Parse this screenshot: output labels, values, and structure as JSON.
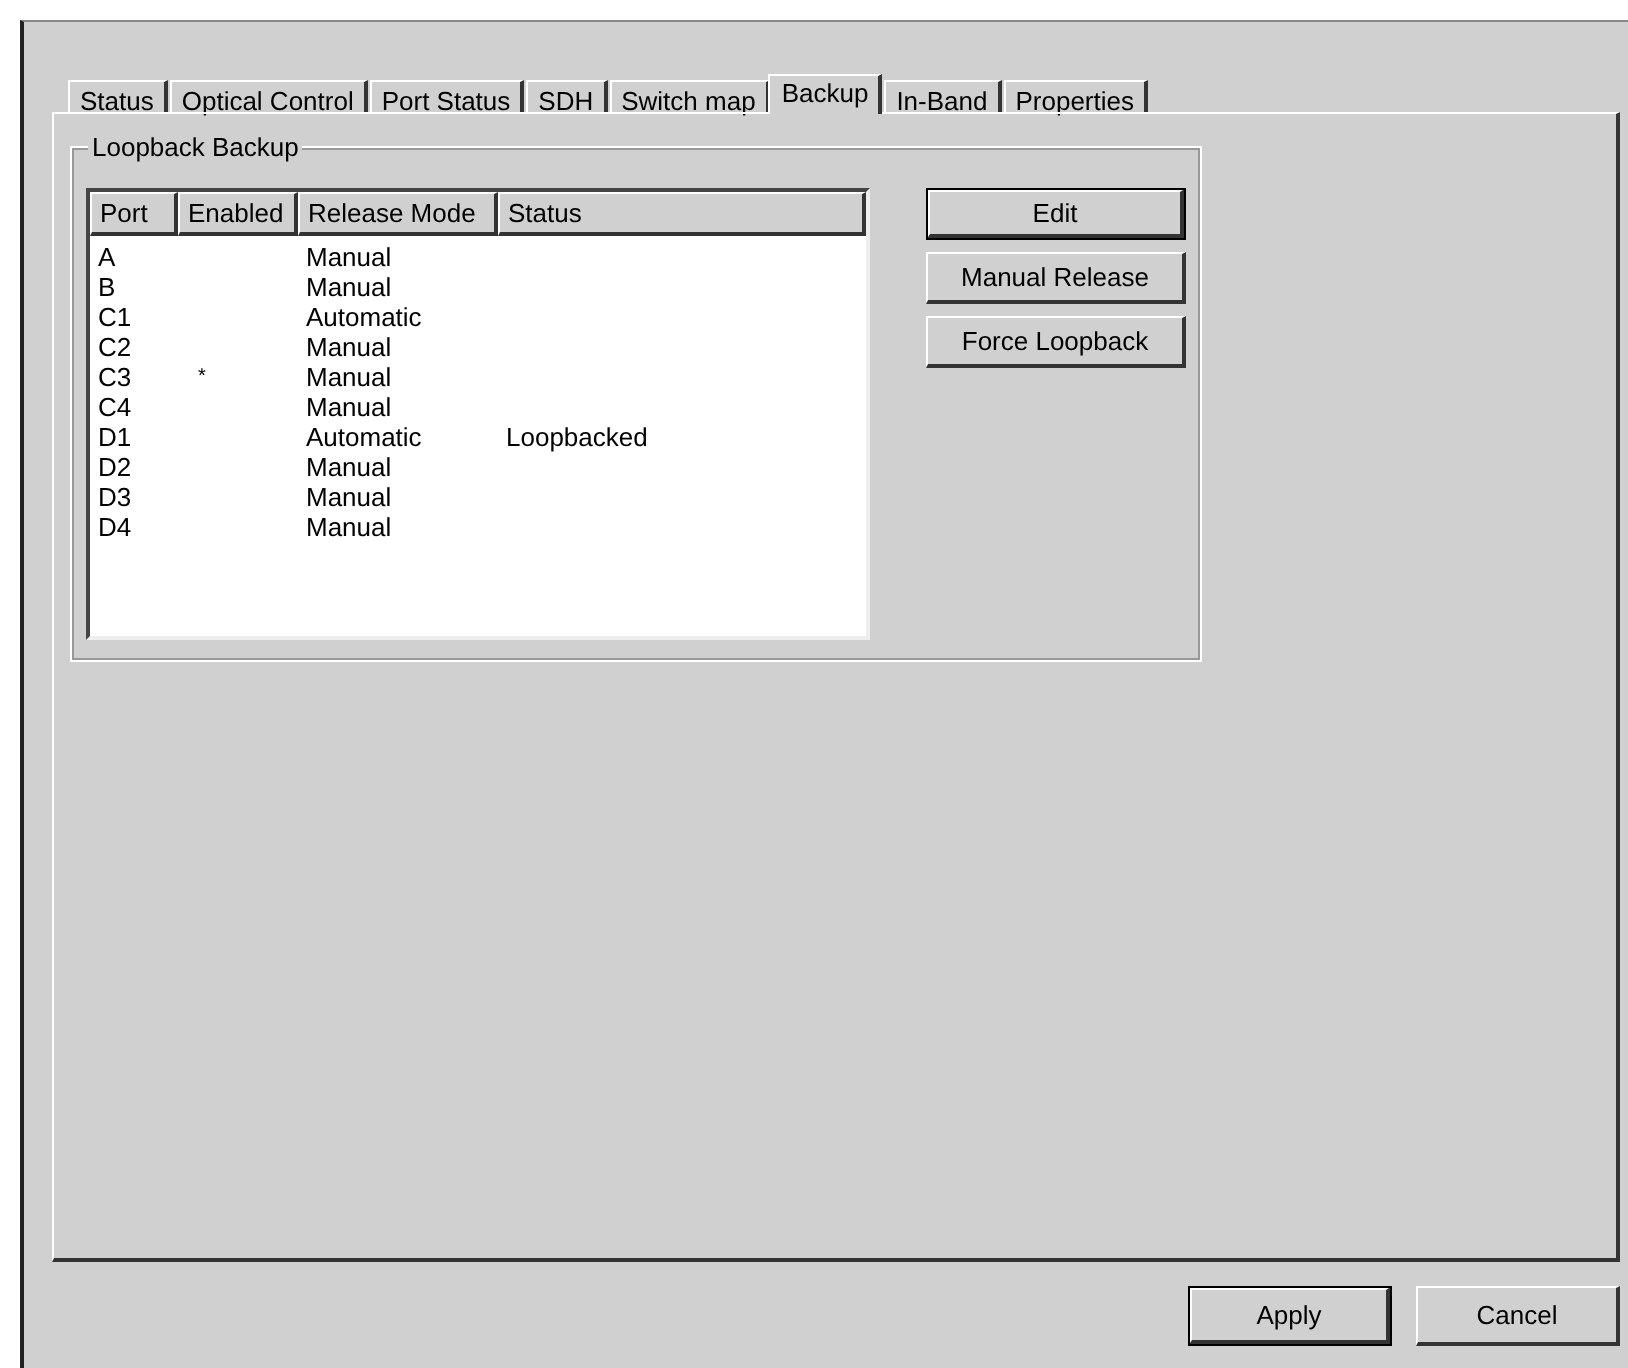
{
  "tabs": [
    {
      "label": "Status",
      "selected": false
    },
    {
      "label": "Optical Control",
      "selected": false
    },
    {
      "label": "Port Status",
      "selected": false
    },
    {
      "label": "SDH",
      "selected": false
    },
    {
      "label": "Switch map",
      "selected": false
    },
    {
      "label": "Backup",
      "selected": true
    },
    {
      "label": "In-Band",
      "selected": false
    },
    {
      "label": "Properties",
      "selected": false
    }
  ],
  "group": {
    "title": "Loopback Backup",
    "table": {
      "columns": [
        "Port",
        "Enabled",
        "Release Mode",
        "Status"
      ],
      "rows": [
        [
          "A",
          "",
          "Manual",
          ""
        ],
        [
          "B",
          "",
          "Manual",
          ""
        ],
        [
          "C1",
          "",
          "Automatic",
          ""
        ],
        [
          "C2",
          "",
          "Manual",
          ""
        ],
        [
          "C3",
          "*",
          "Manual",
          ""
        ],
        [
          "C4",
          "",
          "Manual",
          ""
        ],
        [
          "D1",
          "",
          "Automatic",
          "Loopbacked"
        ],
        [
          "D2",
          "",
          "Manual",
          ""
        ],
        [
          "D3",
          "",
          "Manual",
          ""
        ],
        [
          "D4",
          "",
          "Manual",
          ""
        ]
      ]
    },
    "buttons": [
      {
        "label": "Edit",
        "default": true
      },
      {
        "label": "Manual Release",
        "default": false
      },
      {
        "label": "Force Loopback",
        "default": false
      }
    ]
  },
  "dialog_buttons": [
    {
      "label": "Apply",
      "default": true
    },
    {
      "label": "Cancel",
      "default": false
    }
  ]
}
